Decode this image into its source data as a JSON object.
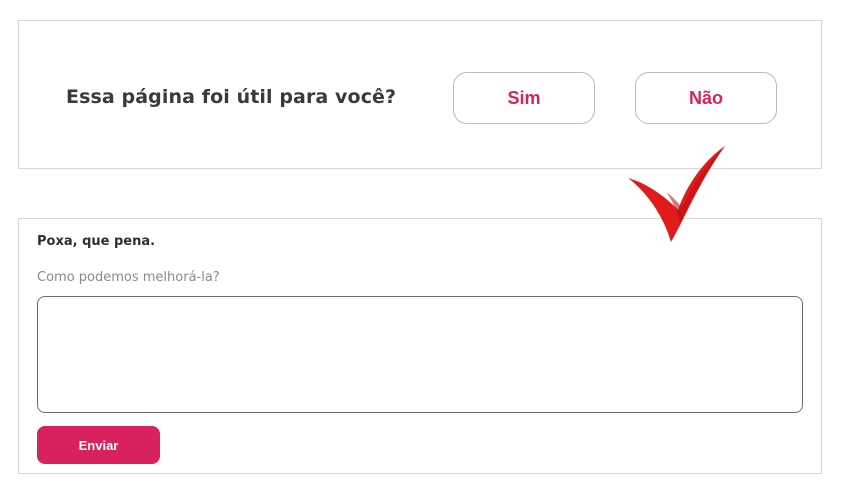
{
  "feedback": {
    "question": "Essa página foi útil para você?",
    "yes_label": "Sim",
    "no_label": "Não"
  },
  "followup": {
    "sorry_text": "Poxa, que pena.",
    "prompt": "Como podemos melhorá-la?",
    "comment_value": "",
    "submit_label": "Enviar"
  },
  "colors": {
    "accent": "#d8225e",
    "annotation_arrow": "#e01b1b"
  },
  "icons": {
    "annotation": "red-check-arrow-icon"
  }
}
